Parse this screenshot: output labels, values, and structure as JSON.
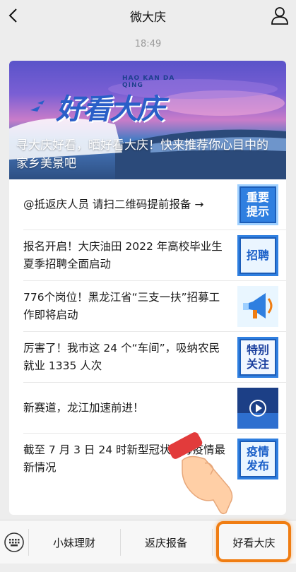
{
  "header": {
    "title": "微大庆"
  },
  "timestamp": "18:49",
  "hero": {
    "logo_latin": "HAO KAN DA QING",
    "logo_text": "好看大庆",
    "caption": "寻大庆好看，晒好看大庆！快来推荐你心目中的家乡美景吧"
  },
  "articles": [
    {
      "text": "@抵返庆人员  请扫二维码提前报备 →",
      "thumb": [
        "重要",
        "提示"
      ],
      "thumb_style": "blue"
    },
    {
      "text": "报名开启！大庆油田 2022 年高校毕业生夏季招聘全面启动",
      "thumb": [
        "招聘"
      ],
      "thumb_style": "white"
    },
    {
      "text": "776个岗位！黑龙江省“三支一扶”招募工作即将启动",
      "thumb": [],
      "thumb_style": "megaphone"
    },
    {
      "text": "厉害了！我市这 24 个“车间”，吸纳农民就业 1335 人次",
      "thumb": [
        "特别",
        "关注"
      ],
      "thumb_style": "white-dark"
    },
    {
      "text": "新赛道，龙江加速前进！",
      "thumb": [],
      "thumb_style": "video"
    },
    {
      "text": "截至 7 月 3 日 24 时新型冠状病毒疫情最新情况",
      "thumb": [
        "疫情",
        "发布"
      ],
      "thumb_style": "white"
    }
  ],
  "bottom_menu": {
    "items": [
      "小妹理财",
      "返庆报备",
      "好看大庆"
    ]
  },
  "colors": {
    "accent": "#2f7fe0",
    "highlight": "#f07d12",
    "background": "#ededed"
  }
}
